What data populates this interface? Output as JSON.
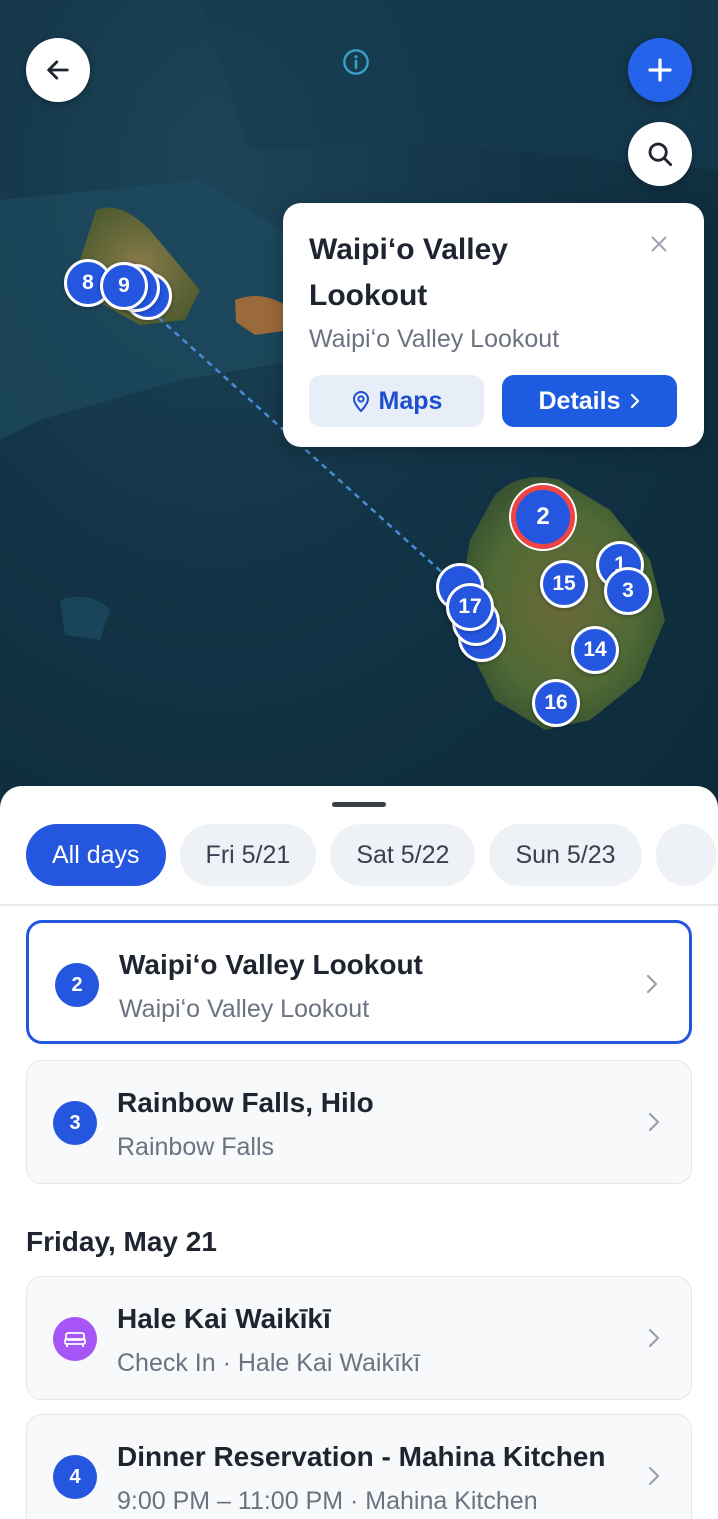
{
  "map": {
    "icons": {
      "back": "arrow-left-icon",
      "add": "plus-icon",
      "search": "search-icon",
      "info": "info-icon"
    },
    "markers": [
      "8",
      "9",
      "2",
      "15",
      "1",
      "3",
      "17",
      "14",
      "16"
    ],
    "popup": {
      "title": "Waipiʻo Valley Lookout",
      "subtitle": "Waipiʻo Valley Lookout",
      "maps_label": "Maps",
      "details_label": "Details"
    }
  },
  "sheet": {
    "days": [
      "All days",
      "Fri 5/21",
      "Sat 5/22",
      "Sun 5/23"
    ],
    "selected_day": "All days",
    "items": [
      {
        "badge": "2",
        "title": "Waipiʻo Valley Lookout",
        "subtitle": "Waipiʻo Valley Lookout",
        "selected": true
      },
      {
        "badge": "3",
        "title": "Rainbow Falls, Hilo",
        "subtitle": "Rainbow Falls"
      }
    ],
    "section_heading": "Friday, May 21",
    "friday_items": [
      {
        "icon": "bed-icon",
        "title": "Hale Kai Waikīkī",
        "subtitle": "Check In · Hale Kai Waikīkī"
      },
      {
        "badge": "4",
        "title": "Dinner Reservation - Mahina Kitchen",
        "subtitle": "9:00 PM – 11:00 PM · Mahina Kitchen"
      }
    ]
  },
  "colors": {
    "accent": "#2456e0",
    "active_marker_ring": "#ef4444",
    "lodging": "#a855f7"
  }
}
